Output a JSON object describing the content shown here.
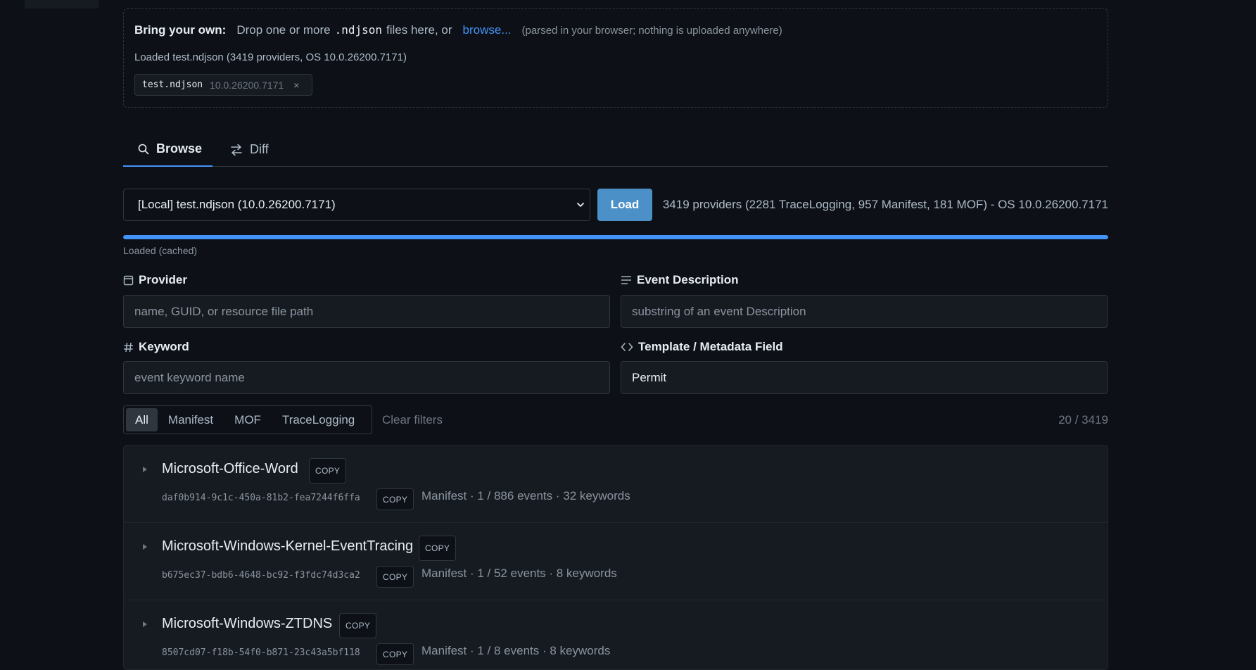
{
  "dropzone": {
    "title": "Bring your own:",
    "text_before": "Drop one or more",
    "ext": ".ndjson",
    "text_after": "files here, or",
    "browse_label": "browse...",
    "note": "(parsed in your browser; nothing is uploaded anywhere)",
    "loaded_status": "Loaded test.ndjson (3419 providers, OS 10.0.26200.7171)",
    "chip": {
      "name": "test.ndjson",
      "version": "10.0.26200.7171",
      "remove": "×"
    }
  },
  "tabs": [
    {
      "label": "Browse",
      "icon": "search-icon",
      "active": true
    },
    {
      "label": "Diff",
      "icon": "diff-arrows-icon",
      "active": false
    }
  ],
  "source": {
    "selected": "[Local] test.ndjson (10.0.26200.7171)",
    "load_label": "Load",
    "summary": "3419 providers (2281 TraceLogging, 957 Manifest, 181 MOF) - OS 10.0.26200.7171",
    "progress_fraction": 1.0,
    "progress_note": "Loaded (cached)"
  },
  "filters": {
    "provider": {
      "label": "Provider",
      "icon": "provider-icon",
      "placeholder": "name, GUID, or resource file path",
      "value": ""
    },
    "event_description": {
      "label": "Event Description",
      "icon": "lines-icon",
      "placeholder": "substring of an event Description",
      "value": ""
    },
    "keyword": {
      "label": "Keyword",
      "icon": "hash-icon",
      "placeholder": "event keyword name",
      "value": ""
    },
    "template": {
      "label": "Template / Metadata Field",
      "icon": "code-icon",
      "placeholder": "",
      "value": "Permit"
    }
  },
  "type_filter": {
    "options": [
      "All",
      "Manifest",
      "MOF",
      "TraceLogging"
    ],
    "selected": "All",
    "clear_label": "Clear filters",
    "count": "20 / 3419"
  },
  "providers": [
    {
      "name": "Microsoft-Office-Word",
      "copy": "COPY",
      "guid": "daf0b914-9c1c-450a-81b2-fea7244f6ffa",
      "meta": "Manifest · 1 / 886 events · 32 keywords"
    },
    {
      "name": "Microsoft-Windows-Kernel-EventTracing",
      "copy": "COPY",
      "guid": "b675ec37-bdb6-4648-bc92-f3fdc74d3ca2",
      "meta": "Manifest · 1 / 52 events · 8 keywords"
    },
    {
      "name": "Microsoft-Windows-ZTDNS",
      "copy": "COPY",
      "guid": "8507cd07-f18b-54f0-b871-23c43a5bf118",
      "meta": "Manifest · 1 / 8 events · 8 keywords"
    }
  ],
  "colors": {
    "background": "#0d1117",
    "accent": "#4493f8",
    "load_button": "#4b91c7"
  }
}
